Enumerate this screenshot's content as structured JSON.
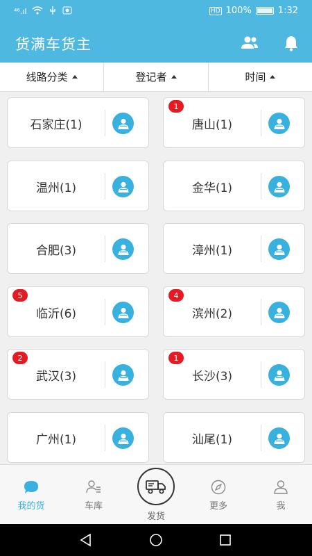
{
  "status": {
    "signal": "⁴⁶.ıl",
    "wifi": "wifi-icon",
    "battery_text": "100%",
    "time": "1:32",
    "hd": "HD"
  },
  "app": {
    "title": "货满车货主",
    "accent": "#4fb8e0"
  },
  "filters": [
    {
      "label": "线路分类"
    },
    {
      "label": "登记者"
    },
    {
      "label": "时间"
    }
  ],
  "routes": [
    {
      "name": "石家庄(1)",
      "badge": ""
    },
    {
      "name": "唐山(1)",
      "badge": "1"
    },
    {
      "name": "温州(1)",
      "badge": ""
    },
    {
      "name": "金华(1)",
      "badge": ""
    },
    {
      "name": "合肥(3)",
      "badge": ""
    },
    {
      "name": "漳州(1)",
      "badge": ""
    },
    {
      "name": "临沂(6)",
      "badge": "5"
    },
    {
      "name": "滨州(2)",
      "badge": "4"
    },
    {
      "name": "武汉(3)",
      "badge": "2"
    },
    {
      "name": "长沙(3)",
      "badge": "1"
    },
    {
      "name": "广州(1)",
      "badge": ""
    },
    {
      "name": "汕尾(1)",
      "badge": ""
    }
  ],
  "nav": {
    "my_goods": "我的货",
    "garage": "车库",
    "ship": "发货",
    "more": "更多",
    "me": "我"
  }
}
